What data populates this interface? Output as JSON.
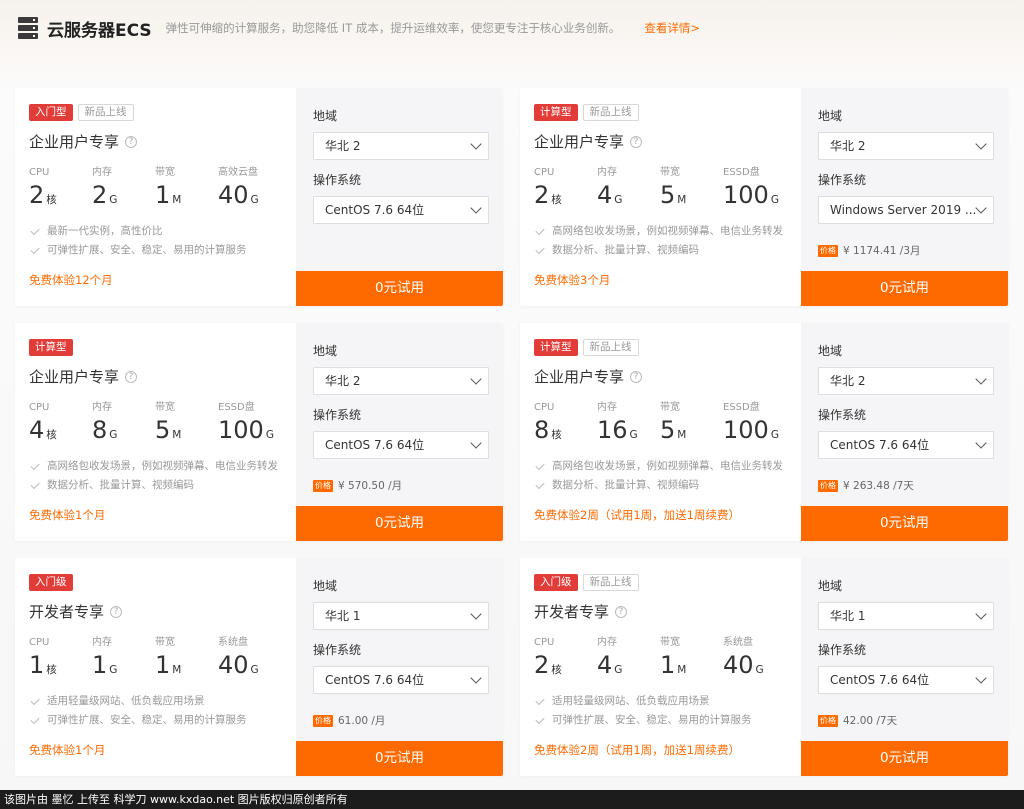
{
  "header": {
    "icon": "server-icon",
    "title": "云服务器ECS",
    "description": "弹性可伸缩的计算服务，助您降低 IT 成本，提升运维效率，使您更专注于核心业务创新。",
    "details_link": "查看详情>"
  },
  "form_labels": {
    "region": "地域",
    "os": "操作系统"
  },
  "cards": [
    {
      "tags": [
        {
          "text": "入门型",
          "style": "red"
        },
        {
          "text": "新品上线",
          "style": "gray"
        }
      ],
      "name": "企业用户专享",
      "specs": [
        {
          "label": "CPU",
          "value": "2",
          "unit": "核"
        },
        {
          "label": "内存",
          "value": "2",
          "unit": "G"
        },
        {
          "label": "带宽",
          "value": "1",
          "unit": "M"
        },
        {
          "label": "高效云盘",
          "value": "40",
          "unit": "G"
        }
      ],
      "features": [
        "最新一代实例，高性价比",
        "可弹性扩展、安全、稳定、易用的计算服务"
      ],
      "trial_text": "免费体验12个月",
      "region": "华北 2",
      "os": "CentOS 7.6 64位",
      "price": "",
      "button": "0元试用"
    },
    {
      "tags": [
        {
          "text": "计算型",
          "style": "red"
        },
        {
          "text": "新品上线",
          "style": "gray"
        }
      ],
      "name": "企业用户专享",
      "specs": [
        {
          "label": "CPU",
          "value": "2",
          "unit": "核"
        },
        {
          "label": "内存",
          "value": "4",
          "unit": "G"
        },
        {
          "label": "带宽",
          "value": "5",
          "unit": "M"
        },
        {
          "label": "ESSD盘",
          "value": "100",
          "unit": "G"
        }
      ],
      "features": [
        "高网络包收发场景，例如视频弹幕、电信业务转发",
        "数据分析、批量计算、视频编码"
      ],
      "trial_text": "免费体验3个月",
      "region": "华北 2",
      "os": "Windows Server 2019 ...",
      "price_badge": "价格",
      "price": "¥ 1174.41 /3月",
      "button": "0元试用"
    },
    {
      "tags": [
        {
          "text": "计算型",
          "style": "red"
        }
      ],
      "name": "企业用户专享",
      "specs": [
        {
          "label": "CPU",
          "value": "4",
          "unit": "核"
        },
        {
          "label": "内存",
          "value": "8",
          "unit": "G"
        },
        {
          "label": "带宽",
          "value": "5",
          "unit": "M"
        },
        {
          "label": "ESSD盘",
          "value": "100",
          "unit": "G"
        }
      ],
      "features": [
        "高网络包收发场景，例如视频弹幕、电信业务转发",
        "数据分析、批量计算、视频编码"
      ],
      "trial_text": "免费体验1个月",
      "region": "华北 2",
      "os": "CentOS 7.6 64位",
      "price_badge": "价格",
      "price": "¥ 570.50 /月",
      "button": "0元试用"
    },
    {
      "tags": [
        {
          "text": "计算型",
          "style": "red"
        },
        {
          "text": "新品上线",
          "style": "gray"
        }
      ],
      "name": "企业用户专享",
      "specs": [
        {
          "label": "CPU",
          "value": "8",
          "unit": "核"
        },
        {
          "label": "内存",
          "value": "16",
          "unit": "G"
        },
        {
          "label": "带宽",
          "value": "5",
          "unit": "M"
        },
        {
          "label": "ESSD盘",
          "value": "100",
          "unit": "G"
        }
      ],
      "features": [
        "高网络包收发场景，例如视频弹幕、电信业务转发",
        "数据分析、批量计算、视频编码"
      ],
      "trial_text": "免费体验2周（试用1周，加送1周续费）",
      "region": "华北 2",
      "os": "CentOS 7.6 64位",
      "price_badge": "价格",
      "price": "¥ 263.48 /7天",
      "button": "0元试用"
    },
    {
      "tags": [
        {
          "text": "入门级",
          "style": "red"
        }
      ],
      "name": "开发者专享",
      "specs": [
        {
          "label": "CPU",
          "value": "1",
          "unit": "核"
        },
        {
          "label": "内存",
          "value": "1",
          "unit": "G"
        },
        {
          "label": "带宽",
          "value": "1",
          "unit": "M"
        },
        {
          "label": "系统盘",
          "value": "40",
          "unit": "G"
        }
      ],
      "features": [
        "适用轻量级网站、低负载应用场景",
        "可弹性扩展、安全、稳定、易用的计算服务"
      ],
      "trial_text": "免费体验1个月",
      "region": "华北 1",
      "os": "CentOS 7.6 64位",
      "price_badge": "价格",
      "price": "61.00 /月",
      "button": "0元试用"
    },
    {
      "tags": [
        {
          "text": "入门级",
          "style": "red"
        },
        {
          "text": "新品上线",
          "style": "gray"
        }
      ],
      "name": "开发者专享",
      "specs": [
        {
          "label": "CPU",
          "value": "2",
          "unit": "核"
        },
        {
          "label": "内存",
          "value": "4",
          "unit": "G"
        },
        {
          "label": "带宽",
          "value": "1",
          "unit": "M"
        },
        {
          "label": "系统盘",
          "value": "40",
          "unit": "G"
        }
      ],
      "features": [
        "适用轻量级网站、低负载应用场景",
        "可弹性扩展、安全、稳定、易用的计算服务"
      ],
      "trial_text": "免费体验2周（试用1周，加送1周续费）",
      "region": "华北 1",
      "os": "CentOS 7.6 64位",
      "price_badge": "价格",
      "price": "42.00 /7天",
      "button": "0元试用"
    }
  ],
  "footer": {
    "text": "该图片由 墨忆 上传至 科学刀 www.kxdao.net 图片版权归原创者所有"
  },
  "colors": {
    "accent": "#ff6a00",
    "tag_red": "#e23c39",
    "panel_bg": "#f5f5f7"
  }
}
